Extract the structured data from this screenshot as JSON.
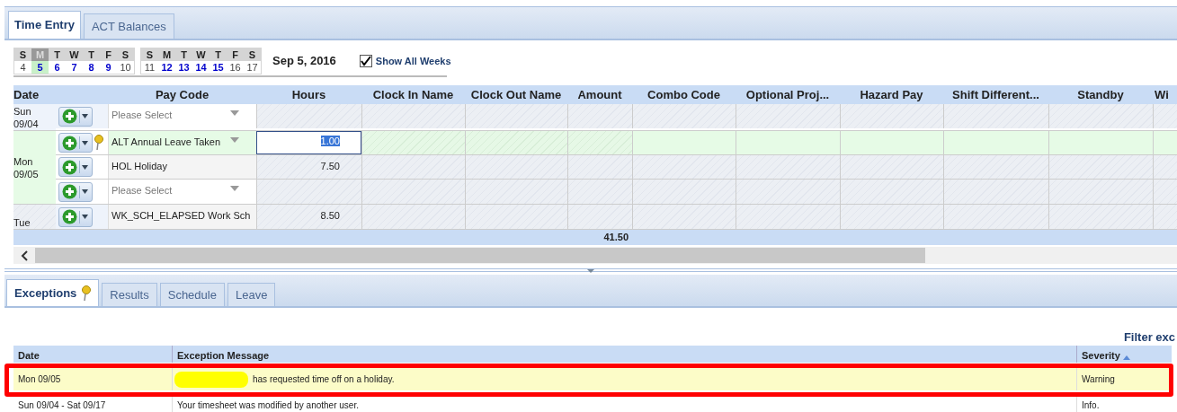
{
  "top_tabs": [
    {
      "label": "Time Entry",
      "selected": true
    },
    {
      "label": "ACT Balances",
      "selected": false
    }
  ],
  "calendar": {
    "weeks": [
      {
        "days": [
          {
            "letter": "S",
            "date": "4",
            "selected": false,
            "scheduled": false
          },
          {
            "letter": "M",
            "date": "5",
            "selected": true,
            "scheduled": true
          },
          {
            "letter": "T",
            "date": "6",
            "selected": false,
            "scheduled": true
          },
          {
            "letter": "W",
            "date": "7",
            "selected": false,
            "scheduled": true
          },
          {
            "letter": "T",
            "date": "8",
            "selected": false,
            "scheduled": true
          },
          {
            "letter": "F",
            "date": "9",
            "selected": false,
            "scheduled": true
          },
          {
            "letter": "S",
            "date": "10",
            "selected": false,
            "scheduled": false
          }
        ]
      },
      {
        "days": [
          {
            "letter": "S",
            "date": "11",
            "selected": false,
            "scheduled": false
          },
          {
            "letter": "M",
            "date": "12",
            "selected": false,
            "scheduled": true
          },
          {
            "letter": "T",
            "date": "13",
            "selected": false,
            "scheduled": true
          },
          {
            "letter": "W",
            "date": "14",
            "selected": false,
            "scheduled": true
          },
          {
            "letter": "T",
            "date": "15",
            "selected": false,
            "scheduled": true
          },
          {
            "letter": "F",
            "date": "16",
            "selected": false,
            "scheduled": false
          },
          {
            "letter": "S",
            "date": "17",
            "selected": false,
            "scheduled": false
          }
        ]
      }
    ],
    "current_date": "Sep 5, 2016",
    "show_all_weeks": {
      "label": "Show All Weeks",
      "checked": true
    }
  },
  "grid": {
    "columns": [
      "Date",
      "Pay Code",
      "Hours",
      "Clock In Name",
      "Clock Out Name",
      "Amount",
      "Combo Code",
      "Optional Proj...",
      "Hazard Pay",
      "Shift Different...",
      "Standby",
      "Wi"
    ],
    "days": [
      {
        "day": "Sun",
        "date": "09/04",
        "selected": false,
        "entries": [
          {
            "placeholder": "Please Select",
            "editing": false,
            "flagged": false
          }
        ]
      },
      {
        "day": "Mon",
        "date": "09/05",
        "selected": true,
        "entries": [
          {
            "pay_code": "ALT Annual Leave Taken",
            "hours": "1.00",
            "editing": true,
            "flagged": true
          },
          {
            "pay_code": "HOL Holiday",
            "hours": "7.50",
            "editing": false,
            "flagged": false
          },
          {
            "placeholder": "Please Select",
            "editing": false,
            "flagged": false
          }
        ]
      },
      {
        "day": "Tue",
        "selected": false,
        "entries": [
          {
            "pay_code": "WK_SCH_ELAPSED Work Sch",
            "hours": "8.50",
            "editing": false,
            "flagged": false
          }
        ]
      }
    ],
    "total": "41.50"
  },
  "bottom_tabs": [
    {
      "label": "Exceptions",
      "selected": true,
      "flagged": true
    },
    {
      "label": "Results",
      "selected": false,
      "flagged": false
    },
    {
      "label": "Schedule",
      "selected": false,
      "flagged": false
    },
    {
      "label": "Leave",
      "selected": false,
      "flagged": false
    }
  ],
  "filter_link": "Filter exc",
  "exceptions": {
    "columns": [
      "Date",
      "Exception Message",
      "Severity"
    ],
    "rows": [
      {
        "date": "Mon 09/05",
        "message": "has requested time off on a holiday.",
        "severity": "Warning",
        "highlighted": true,
        "redacted": true
      },
      {
        "date": "Sun 09/04 - Sat 09/17",
        "message": "Your timesheet was modified by another user.",
        "severity": "Info.",
        "highlighted": false,
        "redacted": false
      }
    ]
  }
}
